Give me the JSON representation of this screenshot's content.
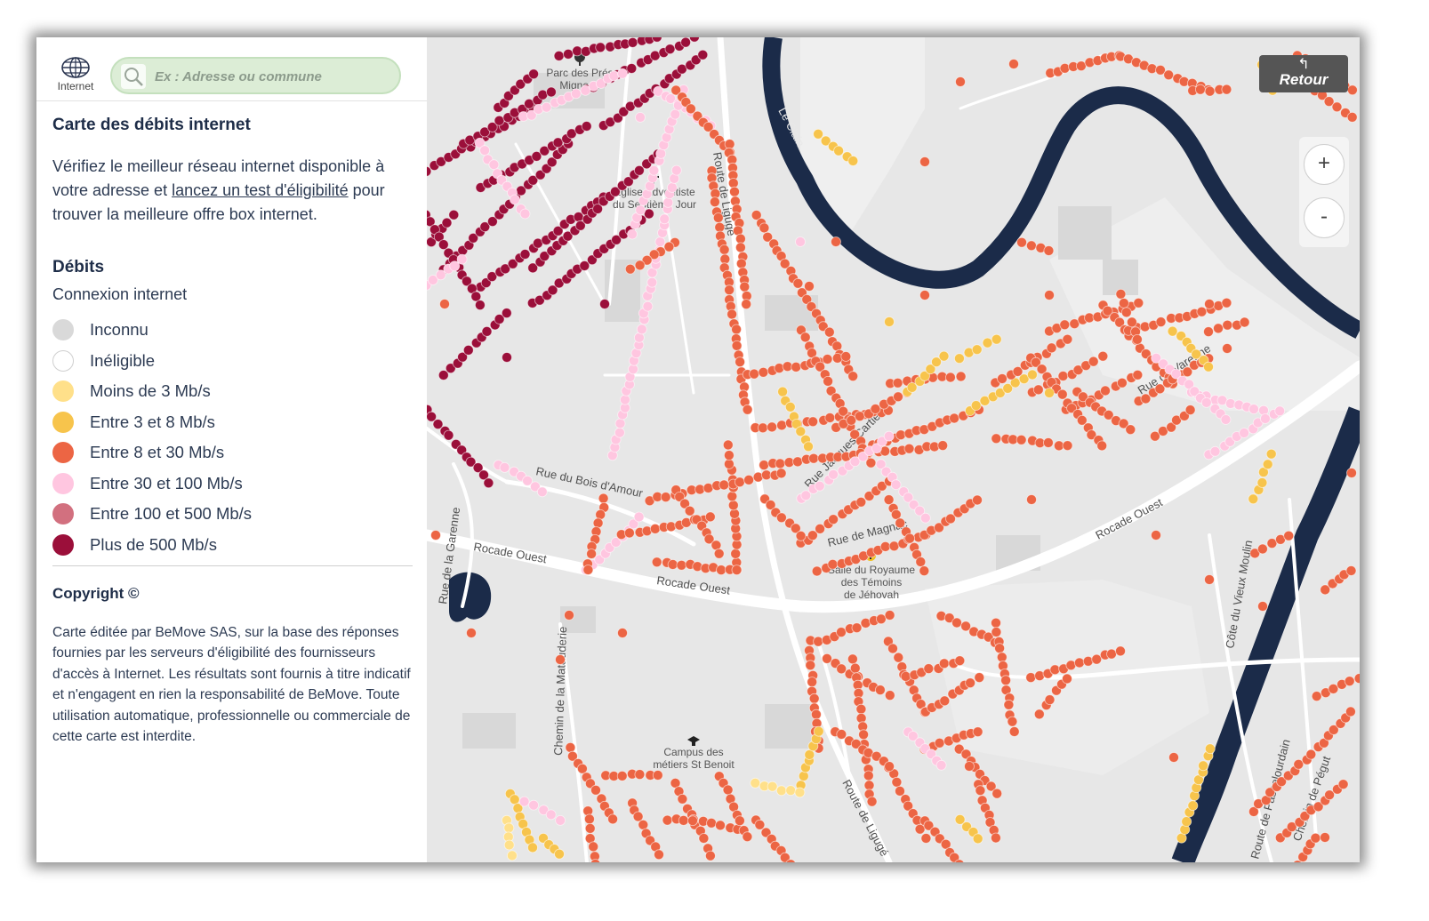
{
  "header": {
    "globe_label": "Internet",
    "search_placeholder": "Ex : Adresse ou commune"
  },
  "title": "Carte des débits internet",
  "description": {
    "part1": "Vérifiez le meilleur réseau internet disponible à votre adresse et ",
    "link": "lancez un test d'éligibilité",
    "part2": " pour trouver la meilleure offre box internet."
  },
  "legend": {
    "heading": "Débits",
    "subheading": "Connexion internet",
    "items": [
      {
        "label": "Inconnu",
        "color": "#d9d9d9"
      },
      {
        "label": "Inéligible",
        "color": "#ffffff"
      },
      {
        "label": "Moins de 3 Mb/s",
        "color": "#ffe08a"
      },
      {
        "label": "Entre 3 et 8 Mb/s",
        "color": "#f7c44c"
      },
      {
        "label": "Entre 8 et 30 Mb/s",
        "color": "#ec6544"
      },
      {
        "label": "Entre 30 et 100 Mb/s",
        "color": "#ffc6e0"
      },
      {
        "label": "Entre 100 et 500 Mb/s",
        "color": "#d2707f"
      },
      {
        "label": "Plus de 500 Mb/s",
        "color": "#9b0f3a"
      }
    ]
  },
  "copyright": {
    "heading": "Copyright ©",
    "text": "Carte éditée par BeMove SAS, sur la base des réponses fournies par les serveurs d'éligibilité des fournisseurs d'accès à Internet. Les résultats sont fournis à titre indicatif et n'engagent en rien la responsabilité de BeMove. Toute utilisation automatique, professionnelle ou commerciale de cette carte est interdite."
  },
  "map": {
    "retour_label": "Retour",
    "zoom_in": "+",
    "zoom_out": "-",
    "labels": {
      "parc": [
        "Parc des Prés",
        "Mignons"
      ],
      "eglise": [
        "Église Adventiste",
        "du Septième Jour"
      ],
      "route_liguge_n": "Route de Ligugé",
      "le_clain": "Le Clain",
      "rue_bois": "Rue du Bois d'Amour",
      "rue_garenne": "Rue de la Garenne",
      "rocade_w": "Rocade Ouest",
      "rocade_c": "Rocade Ouest",
      "rocade_e": "Rocade Ouest",
      "rue_jacques": "Rue Jacques Cartier",
      "rue_magnac": "Rue de Magnac",
      "salle": [
        "Salle du Royaume",
        "des Témoins",
        "de Jéhovah"
      ],
      "rue_varenne": "Rue de Varenne",
      "chemin_mat": "Chemin de la Matauderie",
      "campus": [
        "Campus des",
        "métiers St Benoit"
      ],
      "route_liguge_s": "Route de Ligugé",
      "cote_vieux": "Côte du Vieux Moulin",
      "route_passe": "Route de Passelourdain",
      "chemin_pegut": "Chemin de Pégut"
    },
    "colors": {
      "unknown": "#d9d9d9",
      "lt3": "#ffe08a",
      "3to8": "#f7c44c",
      "8to30": "#ec6544",
      "30to100": "#ffc6e0",
      "100to500": "#d2707f",
      "gt500": "#9b0f3a",
      "river": "#1b2b49",
      "road": "#ffffff",
      "ground": "#e7e7e7",
      "block": "#dcdcdc"
    }
  }
}
